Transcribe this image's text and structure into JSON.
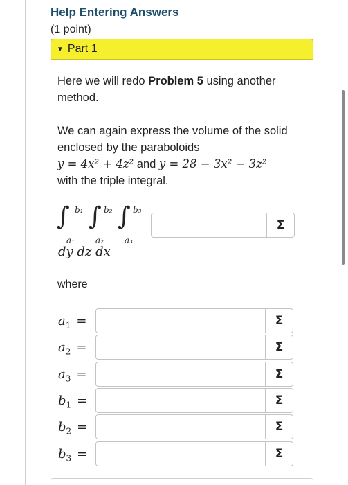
{
  "header": {
    "title": "Help Entering Answers",
    "points": "(1 point)"
  },
  "part": {
    "label": "Part 1",
    "accent_color": "#f5ef2e"
  },
  "intro": {
    "prefix": "Here we will redo ",
    "problem": "Problem 5",
    "suffix": " using another method."
  },
  "statement": {
    "line1": "We can again express the volume of the solid enclosed by the paraboloids",
    "eq1": "y = 4x² + 4z²",
    "and": " and ",
    "eq2": "y = 28 − 3x² − 3z²",
    "line3": "with the triple integral."
  },
  "integral": {
    "upper": [
      "b₁",
      "b₂",
      "b₃"
    ],
    "lower": [
      "a₁",
      "a₂",
      "a₃"
    ],
    "differentials": "dy dz dx",
    "integrand_value": ""
  },
  "where_label": "where",
  "limits": [
    {
      "name": "a",
      "sub": "1",
      "value": ""
    },
    {
      "name": "a",
      "sub": "2",
      "value": ""
    },
    {
      "name": "a",
      "sub": "3",
      "value": ""
    },
    {
      "name": "b",
      "sub": "1",
      "value": ""
    },
    {
      "name": "b",
      "sub": "2",
      "value": ""
    },
    {
      "name": "b",
      "sub": "3",
      "value": ""
    }
  ],
  "sigma_symbol": "Σ",
  "icons": {
    "toggle": "triangle-down-icon",
    "equation_editor": "sigma-icon"
  }
}
